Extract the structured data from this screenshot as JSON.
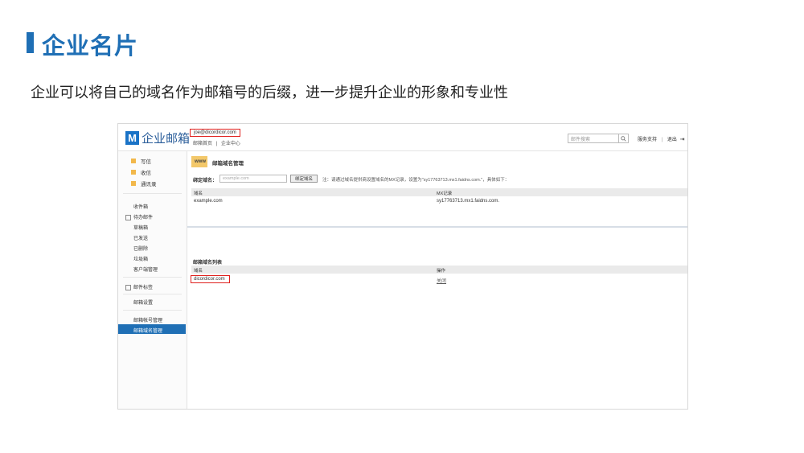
{
  "slide": {
    "title": "企业名片",
    "subtitle": "企业可以将自己的域名作为邮箱号的后缀，进一步提升企业的形象和专业性"
  },
  "colors": {
    "accent": "#1f6fb5",
    "red": "#e0211e",
    "logo": "#1a73c7"
  },
  "header": {
    "logo_letter": "M",
    "logo_text": "企业邮箱",
    "account_email": "joe@dicordicor.com",
    "links": [
      "邮箱首页",
      "|",
      "企业中心"
    ],
    "search_placeholder": "邮件搜索",
    "help": "服务支持",
    "sep": "|",
    "logout": "退出"
  },
  "sidebar": {
    "main": [
      "写信",
      "收信",
      "通讯录"
    ],
    "items": [
      "收件箱",
      "待办邮件",
      "草稿箱",
      "已发送",
      "已删除",
      "垃圾箱",
      "客户端管理"
    ],
    "tags": "邮件标签",
    "settings": "邮箱设置",
    "account_mgmt": "邮箱帐号管理",
    "domain_mgmt": "邮箱域名管理"
  },
  "domain_section": {
    "www": "www",
    "title": "邮箱域名管理",
    "bind_label": "绑定域名：",
    "bind_placeholder": "example.com",
    "bind_button": "绑定域名",
    "note": "注：请通过域名提供商设置域名的MX记录，设置为\"sy17763713.mx1.faidns.com.\"，具体如下：",
    "columns": [
      "域名",
      "MX记录"
    ],
    "row": [
      "example.com",
      "sy17763713.mx1.faidns.com."
    ]
  },
  "domain_list": {
    "title": "邮箱域名列表",
    "columns": [
      "域名",
      "操作"
    ],
    "row": [
      "dicordicor.com",
      "关闭"
    ]
  }
}
